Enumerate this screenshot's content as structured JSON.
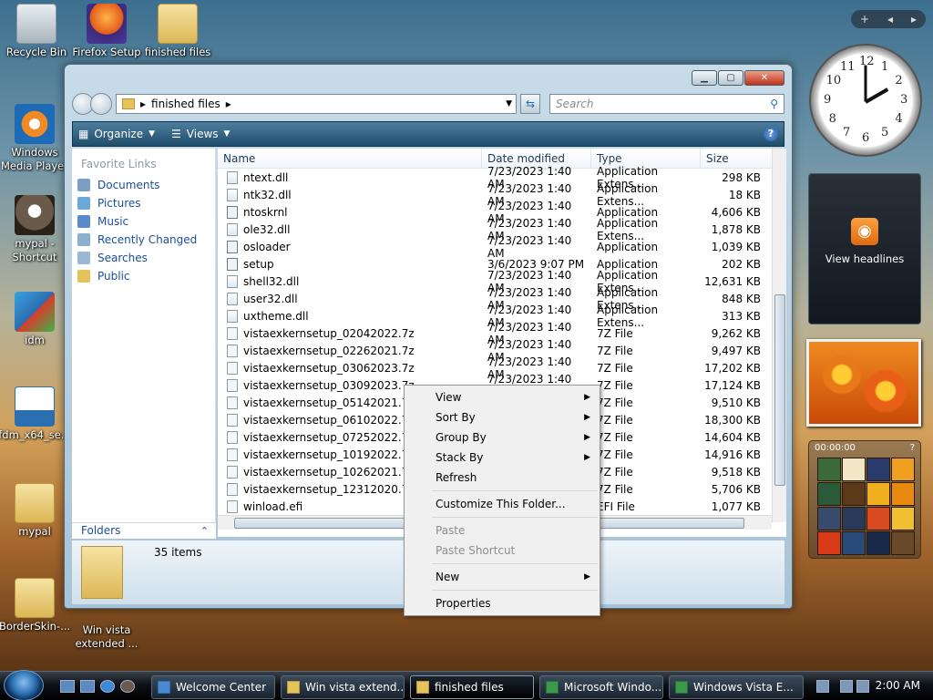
{
  "desktop": {
    "icons": [
      {
        "label": "Recycle Bin"
      },
      {
        "label": "Firefox Setup"
      },
      {
        "label": "finished files"
      },
      {
        "label": "Windows Media Player"
      },
      {
        "label": "mypal - Shortcut"
      },
      {
        "label": "idm"
      },
      {
        "label": "fdm_x64_se..."
      },
      {
        "label": "mypal"
      },
      {
        "label": "BorderSkin-..."
      },
      {
        "label": "Win vista extended ..."
      }
    ]
  },
  "sidebar_gadgets": {
    "controls": {
      "add": "+",
      "prev": "◂",
      "next": "▸"
    },
    "clock": {
      "hour": 2,
      "minute": 0,
      "numbers": [
        "12",
        "1",
        "2",
        "3",
        "4",
        "5",
        "6",
        "7",
        "8",
        "9",
        "10",
        "11"
      ]
    },
    "rss": {
      "label": "View headlines"
    },
    "puzzle": {
      "timer": "00:00:00",
      "help": "?"
    }
  },
  "explorer": {
    "address": {
      "path_segment": "finished files",
      "separator": "▸"
    },
    "search": {
      "placeholder": "Search"
    },
    "toolbar": {
      "organize": "Organize",
      "views": "Views",
      "help": "?"
    },
    "favorite_links_title": "Favorite Links",
    "favorite_links": [
      "Documents",
      "Pictures",
      "Music",
      "Recently Changed",
      "Searches",
      "Public"
    ],
    "folders_label": "Folders",
    "columns": {
      "name": "Name",
      "date": "Date modified",
      "type": "Type",
      "size": "Size"
    },
    "files": [
      {
        "name": "ntext.dll",
        "date": "7/23/2023 1:40 AM",
        "type": "Application Extens...",
        "size": "298 KB",
        "icon": "dll"
      },
      {
        "name": "ntk32.dll",
        "date": "7/23/2023 1:40 AM",
        "type": "Application Extens...",
        "size": "18 KB",
        "icon": "dll"
      },
      {
        "name": "ntoskrnl",
        "date": "7/23/2023 1:40 AM",
        "type": "Application",
        "size": "4,606 KB",
        "icon": "app"
      },
      {
        "name": "ole32.dll",
        "date": "7/23/2023 1:40 AM",
        "type": "Application Extens...",
        "size": "1,878 KB",
        "icon": "dll"
      },
      {
        "name": "osloader",
        "date": "7/23/2023 1:40 AM",
        "type": "Application",
        "size": "1,039 KB",
        "icon": "app"
      },
      {
        "name": "setup",
        "date": "3/6/2023 9:07 PM",
        "type": "Application",
        "size": "202 KB",
        "icon": "app"
      },
      {
        "name": "shell32.dll",
        "date": "7/23/2023 1:40 AM",
        "type": "Application Extens...",
        "size": "12,631 KB",
        "icon": "dll"
      },
      {
        "name": "user32.dll",
        "date": "7/23/2023 1:40 AM",
        "type": "Application Extens...",
        "size": "848 KB",
        "icon": "dll"
      },
      {
        "name": "uxtheme.dll",
        "date": "7/23/2023 1:40 AM",
        "type": "Application Extens...",
        "size": "313 KB",
        "icon": "dll"
      },
      {
        "name": "vistaexkernsetup_02042022.7z",
        "date": "7/23/2023 1:40 AM",
        "type": "7Z File",
        "size": "9,262 KB",
        "icon": "file"
      },
      {
        "name": "vistaexkernsetup_02262021.7z",
        "date": "7/23/2023 1:40 AM",
        "type": "7Z File",
        "size": "9,497 KB",
        "icon": "file"
      },
      {
        "name": "vistaexkernsetup_03062023.7z",
        "date": "7/23/2023 1:40 AM",
        "type": "7Z File",
        "size": "17,202 KB",
        "icon": "file"
      },
      {
        "name": "vistaexkernsetup_03092023.7z",
        "date": "7/23/2023 1:40 AM",
        "type": "7Z File",
        "size": "17,124 KB",
        "icon": "file"
      },
      {
        "name": "vistaexkernsetup_05142021.7z",
        "date": "",
        "type": "7Z File",
        "size": "9,510 KB",
        "icon": "file"
      },
      {
        "name": "vistaexkernsetup_06102022.7z",
        "date": "",
        "type": "7Z File",
        "size": "18,300 KB",
        "icon": "file"
      },
      {
        "name": "vistaexkernsetup_07252022.7z",
        "date": "",
        "type": "7Z File",
        "size": "14,604 KB",
        "icon": "file"
      },
      {
        "name": "vistaexkernsetup_10192022.7z",
        "date": "",
        "type": "7Z File",
        "size": "14,916 KB",
        "icon": "file"
      },
      {
        "name": "vistaexkernsetup_10262021.7z",
        "date": "",
        "type": "7Z File",
        "size": "9,518 KB",
        "icon": "file"
      },
      {
        "name": "vistaexkernsetup_12312020.7z",
        "date": "",
        "type": "7Z File",
        "size": "5,706 KB",
        "icon": "file"
      },
      {
        "name": "winload.efi",
        "date": "",
        "type": "EFI File",
        "size": "1,077 KB",
        "icon": "file"
      }
    ],
    "details": {
      "item_count": "35 items"
    }
  },
  "context_menu": {
    "items": [
      {
        "label": "View",
        "submenu": true,
        "disabled": false
      },
      {
        "label": "Sort By",
        "submenu": true,
        "disabled": false
      },
      {
        "label": "Group By",
        "submenu": true,
        "disabled": false
      },
      {
        "label": "Stack By",
        "submenu": true,
        "disabled": false
      },
      {
        "label": "Refresh",
        "submenu": false,
        "disabled": false
      },
      {
        "separator": true
      },
      {
        "label": "Customize This Folder...",
        "submenu": false,
        "disabled": false
      },
      {
        "separator": true
      },
      {
        "label": "Paste",
        "submenu": false,
        "disabled": true
      },
      {
        "label": "Paste Shortcut",
        "submenu": false,
        "disabled": true
      },
      {
        "separator": true
      },
      {
        "label": "New",
        "submenu": true,
        "disabled": false
      },
      {
        "separator": true
      },
      {
        "label": "Properties",
        "submenu": false,
        "disabled": false
      }
    ]
  },
  "taskbar": {
    "tasks": [
      {
        "label": "Welcome Center",
        "active": false
      },
      {
        "label": "Win vista extend...",
        "active": false
      },
      {
        "label": "finished files",
        "active": true
      },
      {
        "label": "Microsoft Windo...",
        "active": false
      },
      {
        "label": "Windows Vista E...",
        "active": false
      }
    ],
    "clock": "2:00 AM"
  }
}
